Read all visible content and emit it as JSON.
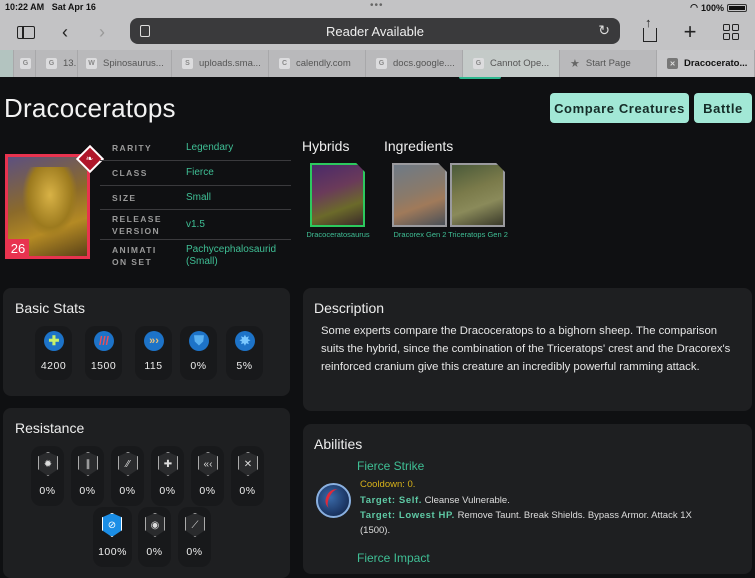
{
  "status_bar": {
    "time": "10:22 AM",
    "date": "Sat Apr 16",
    "battery": "100%"
  },
  "browser": {
    "url_text": "Reader Available",
    "icons": [
      "sidebar-icon",
      "back-icon",
      "forward-icon",
      "reader-icon",
      "reload-icon",
      "share-icon",
      "new-tab-icon",
      "tab-overview-icon"
    ],
    "tabs": [
      {
        "favicon": "G",
        "title": ""
      },
      {
        "favicon": "G",
        "title": "13."
      },
      {
        "favicon": "W",
        "title": "Spinosaurus..."
      },
      {
        "favicon": "S",
        "title": "uploads.sma..."
      },
      {
        "favicon": "C",
        "title": "calendly.com"
      },
      {
        "favicon": "G",
        "title": "docs.google...."
      },
      {
        "favicon": "G",
        "title": "Cannot Ope..."
      },
      {
        "favicon": "★",
        "title": "Start Page"
      },
      {
        "favicon": "✕",
        "title": "Dracocerato...",
        "active": true
      }
    ]
  },
  "creature": {
    "name": "Dracoceratops",
    "level": "26",
    "rarity_color": "#e8334f",
    "info": [
      {
        "label": "RARITY",
        "value": "Legendary"
      },
      {
        "label": "CLASS",
        "value": "Fierce"
      },
      {
        "label": "SIZE",
        "value": "Small"
      },
      {
        "label": "RELEASE VERSION",
        "value": "v1.5"
      },
      {
        "label": "ANIMATI ON SET",
        "value": "Pachycephalosaurid (Small)"
      }
    ]
  },
  "actions": {
    "compare_label": "Compare Creatures",
    "battle_label": "Battle"
  },
  "hybrids": {
    "title": "Hybrids",
    "items": [
      {
        "name": "Dracoceratosaurus"
      }
    ]
  },
  "ingredients": {
    "title": "Ingredients",
    "items": [
      {
        "name": "Dracorex Gen 2"
      },
      {
        "name": "Triceratops Gen 2"
      }
    ]
  },
  "basic_stats": {
    "title": "Basic Stats",
    "items": [
      {
        "icon": "health-icon",
        "value": "4200"
      },
      {
        "icon": "damage-icon",
        "value": "1500"
      },
      {
        "icon": "speed-icon",
        "value": "115"
      },
      {
        "icon": "armor-icon",
        "value": "0%"
      },
      {
        "icon": "critical-chance-icon",
        "value": "5%"
      }
    ]
  },
  "resistance": {
    "title": "Resistance",
    "items": [
      {
        "icon": "crit-reduction-resist-icon",
        "value": "0%"
      },
      {
        "icon": "damage-over-time-resist-icon",
        "value": "0%"
      },
      {
        "icon": "distraction-resist-icon",
        "value": "0%"
      },
      {
        "icon": "heal-reduction-resist-icon",
        "value": "0%"
      },
      {
        "icon": "rend-resist-icon",
        "value": "0%"
      },
      {
        "icon": "speed-reduction-resist-icon",
        "value": "0%"
      },
      {
        "icon": "stun-resist-icon",
        "value": "100%",
        "active": true
      },
      {
        "icon": "swap-prevention-resist-icon",
        "value": "0%"
      },
      {
        "icon": "taunt-resist-icon",
        "value": "0%"
      }
    ]
  },
  "description": {
    "title": "Description",
    "text": "Some experts compare the Dracoceratops to a bighorn sheep. The comparison suits the hybrid, since the combination of the Triceratops' crest and the Dracorex's reinforced cranium give this creature an incredibly powerful ramming attack."
  },
  "abilities": {
    "title": "Abilities",
    "items": [
      {
        "name": "Fierce Strike",
        "cooldown": "Cooldown: 0.",
        "lines": [
          {
            "target": "Target: Self.",
            "effect": "Cleanse Vulnerable."
          },
          {
            "target": "Target: Lowest HP.",
            "effect": "Remove Taunt. Break Shields. Bypass Armor. Attack 1X"
          }
        ],
        "continuation": "(1500)."
      },
      {
        "name": "Fierce Impact"
      }
    ]
  }
}
